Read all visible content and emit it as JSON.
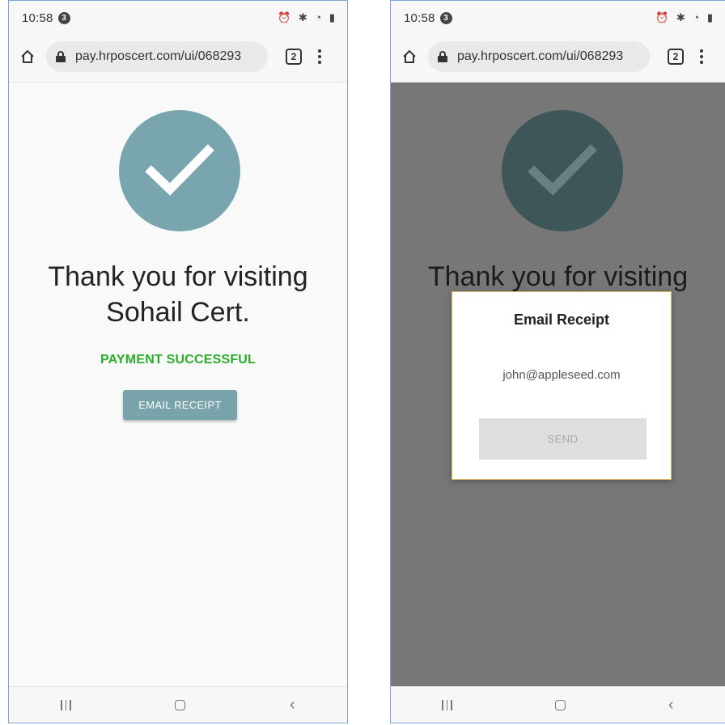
{
  "screens": [
    {
      "status": {
        "time": "10:58",
        "badge": "3"
      },
      "browser": {
        "url": "pay.hrposcert.com/ui/068293",
        "tab_count": "2"
      },
      "page": {
        "thanks_line1": "Thank you for visiting",
        "thanks_line2": "Sohail Cert.",
        "payment_status": "PAYMENT SUCCESSFUL",
        "email_receipt_button": "EMAIL RECEIPT"
      }
    },
    {
      "status": {
        "time": "10:58",
        "badge": "3"
      },
      "browser": {
        "url": "pay.hrposcert.com/ui/068293",
        "tab_count": "2"
      },
      "page": {
        "thanks_line1": "Thank you for visiting"
      },
      "dialog": {
        "title": "Email Receipt",
        "email": "john@appleseed.com",
        "send_button": "SEND"
      }
    }
  ],
  "colors": {
    "check_circle": "#78a5ae",
    "check_circle_dimmed": "#3e5658",
    "success_text": "#2aad2a",
    "button_bg": "#79a3ab",
    "overlay_bg": "#777777",
    "dialog_border": "#e0b860"
  },
  "icons": [
    "home-icon",
    "lock-icon",
    "tabs-icon",
    "more-vert-icon",
    "check-icon",
    "recent-apps-icon",
    "nav-home-icon",
    "back-icon"
  ]
}
